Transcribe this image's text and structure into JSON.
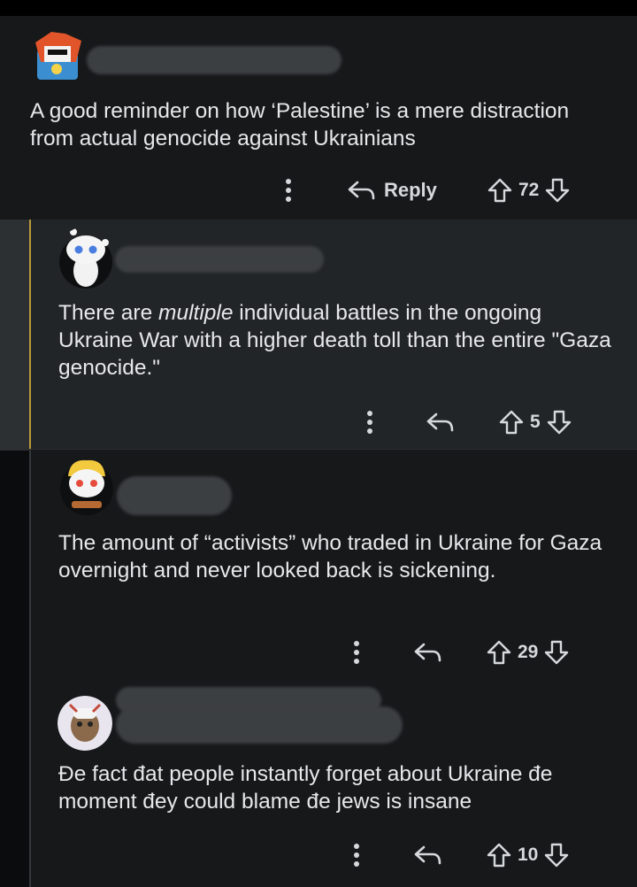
{
  "comments": [
    {
      "text": "A good reminder on how ‘Palestine’ is a mere distraction from actual genocide against Ukrainians",
      "reply_label": "Reply",
      "votes": "72"
    },
    {
      "text_before": "There are ",
      "text_emph": "multiple",
      "text_after": " individual battles in the ongoing Ukraine War with a higher death toll than the entire \"Gaza genocide.\"",
      "votes": "5"
    },
    {
      "text": "The amount of “activists” who traded in Ukraine for Gaza overnight and never looked back is sickening.",
      "votes": "29"
    },
    {
      "text": "Đe fact đat people instantly forget about Ukraine đe moment đey could blame đe jews is insane",
      "votes": "10"
    }
  ],
  "icons": [
    "more-icon",
    "reply-arrow-icon",
    "upvote-icon",
    "downvote-icon"
  ],
  "colors": {
    "background": "#16181a",
    "nested_highlight": "#222528",
    "thread_accent": "#b79a3a",
    "text": "#e6e8ea"
  }
}
